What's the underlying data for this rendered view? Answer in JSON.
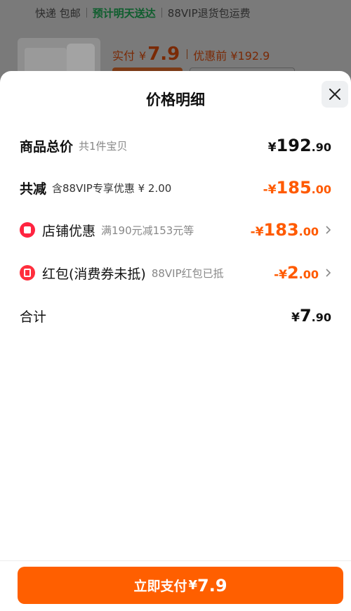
{
  "background": {
    "shipping": "快递 包邮",
    "delivery": "预计明天送达",
    "return_note": "88VIP退货包运费",
    "paid_label": "实付",
    "paid_currency": "¥",
    "paid_value": "7.9",
    "before_discount": "优惠前 ¥192.9"
  },
  "sheet": {
    "title": "价格明细",
    "rows": [
      {
        "label": "商品总价",
        "sub": "共1件宝贝",
        "currency": "¥",
        "int": "192",
        "dec": ".90"
      },
      {
        "label": "共减",
        "sub": "含88VIP专享优惠 ¥ 2.00",
        "currency": "-¥",
        "int": "185",
        "dec": ".00"
      },
      {
        "label": "店铺优惠",
        "sub": "满190元减153元等",
        "currency": "-¥",
        "int": "183",
        "dec": ".00"
      },
      {
        "label": "红包(消费券未抵)",
        "sub": "88VIP红包已抵",
        "currency": "-¥",
        "int": "2",
        "dec": ".00"
      },
      {
        "label": "合计",
        "sub": "",
        "currency": "¥",
        "int": "7",
        "dec": ".90"
      }
    ],
    "pay_button": {
      "label": "立即支付",
      "currency": "¥",
      "value": "7.9"
    }
  },
  "colors": {
    "accent": "#ff5a00",
    "button": "#ff5f00",
    "icon_red": "#ff2440"
  },
  "icons": [
    "close-icon",
    "shop-coupon-icon",
    "red-packet-icon",
    "chevron-right-icon"
  ]
}
